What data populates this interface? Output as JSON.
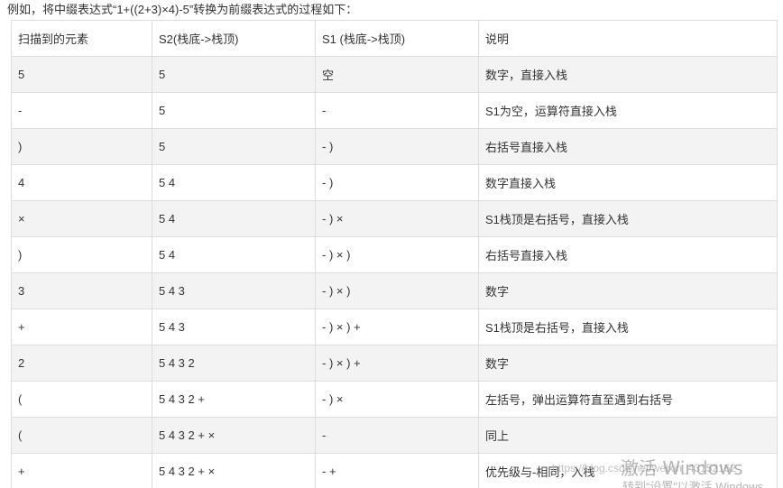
{
  "intro": "例如，将中缀表达式“1+((2+3)×4)-5”转换为前缀表达式的过程如下：",
  "table": {
    "headers": [
      "扫描到的元素",
      "S2(栈底->栈顶)",
      "S1 (栈底->栈顶)",
      "说明"
    ],
    "rows": [
      [
        "5",
        "5",
        "空",
        "数字，直接入栈"
      ],
      [
        "-",
        "5",
        "-",
        "S1为空，运算符直接入栈"
      ],
      [
        ")",
        "5",
        "- )",
        "右括号直接入栈"
      ],
      [
        "4",
        "5 4",
        "- )",
        "数字直接入栈"
      ],
      [
        "×",
        "5 4",
        "- ) ×",
        "S1栈顶是右括号，直接入栈"
      ],
      [
        ")",
        "5 4",
        "- ) × )",
        "右括号直接入栈"
      ],
      [
        "3",
        "5 4 3",
        "- ) × )",
        "数字"
      ],
      [
        "+",
        "5 4 3",
        "- ) × ) +",
        "S1栈顶是右括号，直接入栈"
      ],
      [
        "2",
        "5 4 3 2",
        "- ) × ) +",
        "数字"
      ],
      [
        "(",
        "5 4 3 2 +",
        "- ) ×",
        "左括号，弹出运算符直至遇到右括号"
      ],
      [
        "(",
        "5 4 3 2 + ×",
        "-",
        "同上"
      ],
      [
        "+",
        "5 4 3 2 + ×",
        "- +",
        "优先级与-相同，入栈"
      ]
    ]
  },
  "watermark": "https://blog.csdn.net/weixin_43152162",
  "activation": {
    "title": "激活 Windows",
    "subtitle": "转到“设置”以激活 Windows。"
  }
}
